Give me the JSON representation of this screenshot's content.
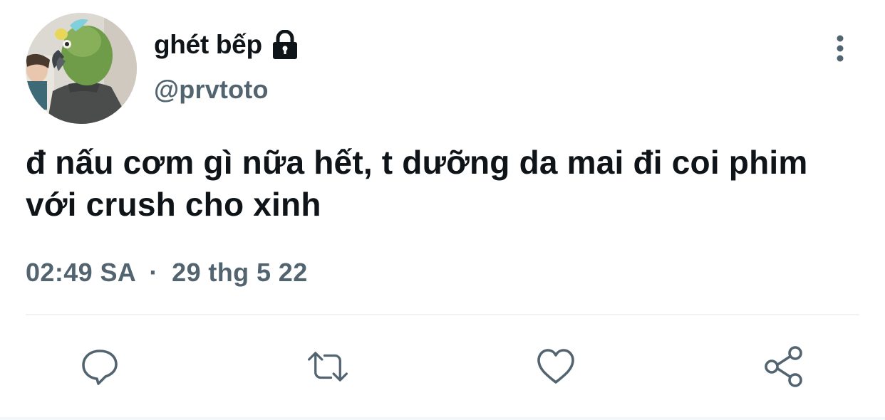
{
  "author": {
    "display_name": "ghét bếp",
    "handle": "@prvtoto",
    "protected_icon": "lock-icon",
    "avatar": "avatar-photo"
  },
  "tweet": {
    "text": "đ nấu cơm gì nữa hết, t dưỡng da mai đi coi phim với crush cho xinh",
    "time": "02:49 SA",
    "separator": "·",
    "date": "29 thg 5 22"
  },
  "actions": [
    {
      "name": "reply",
      "icon": "speech-bubble-icon"
    },
    {
      "name": "retweet",
      "icon": "retweet-arrows-icon"
    },
    {
      "name": "like",
      "icon": "heart-icon"
    },
    {
      "name": "share",
      "icon": "share-nodes-icon"
    }
  ],
  "colors": {
    "text_primary": "#0f1419",
    "text_secondary": "#536471",
    "divider": "#eff3f4",
    "icon": "#536471"
  }
}
